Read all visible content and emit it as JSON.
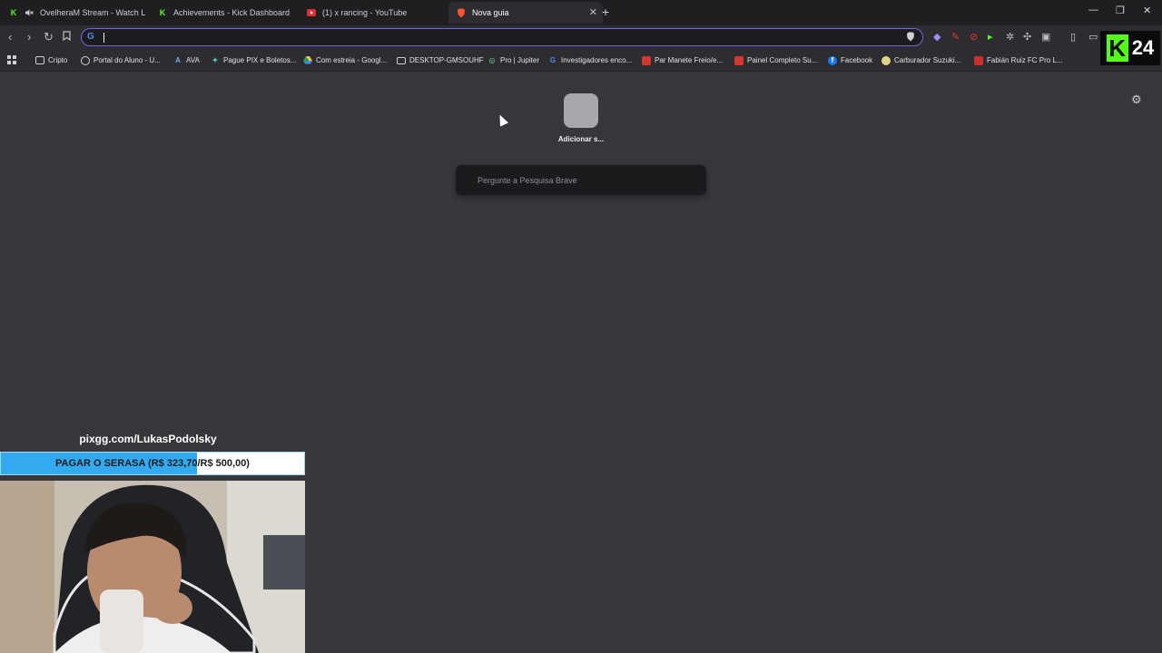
{
  "tabs": [
    {
      "title": "OvelheraM Stream - Watch Live o",
      "icon": "kick-icon",
      "muted": true
    },
    {
      "title": "Achievements - Kick Dashboard",
      "icon": "kick-icon"
    },
    {
      "title": "(1) x rancing - YouTube",
      "icon": "youtube-icon"
    },
    {
      "title": "Nova guia",
      "icon": "brave-icon",
      "active": true
    }
  ],
  "omnibox": {
    "value": ""
  },
  "bookmarks": [
    {
      "label": "Cripto",
      "icon": "folder-icon"
    },
    {
      "label": "Portal do Aluno - U...",
      "icon": "globe-icon"
    },
    {
      "label": "AVA",
      "icon": "ava-icon"
    },
    {
      "label": "Pague PIX e Boletos...",
      "icon": "pix-icon"
    },
    {
      "label": "Com estreia - Googl...",
      "icon": "drive-icon"
    },
    {
      "label": "DESKTOP-GMSOUHF",
      "icon": "monitor-icon"
    },
    {
      "label": "Pro | Jupiter",
      "icon": "jupiter-icon"
    },
    {
      "label": "Investigadores enco...",
      "icon": "google-icon"
    },
    {
      "label": "Par Manete Freio/e...",
      "icon": "shop-icon"
    },
    {
      "label": "Painel Completo Su...",
      "icon": "shop-icon"
    },
    {
      "label": "Facebook",
      "icon": "facebook-icon"
    },
    {
      "label": "Carburador Suzuki...",
      "icon": "shop-icon"
    },
    {
      "label": "Fabián Ruiz FC Pro L...",
      "icon": "fc-icon"
    }
  ],
  "kick_badge": {
    "number": "24"
  },
  "ntp": {
    "tile_label": "Adicionar s...",
    "search_placeholder": "Pergunte a Pesquisa Brave"
  },
  "stream_overlay": {
    "pix_label": "pixgg.com/LukasPodolsky",
    "goal_text": "PAGAR O SERASA (R$ 323,70/R$ 500,00)",
    "goal_current": 323.7,
    "goal_target": 500.0
  },
  "colors": {
    "background": "#36363b",
    "omnibox_border": "#6e6ad9",
    "kick_green": "#53fc18",
    "goal_fill": "#33aaf0"
  }
}
